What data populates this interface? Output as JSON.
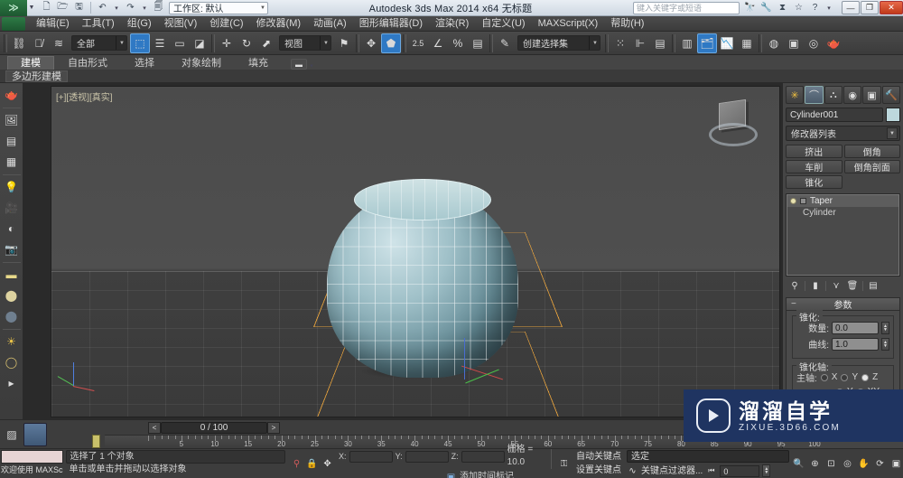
{
  "window": {
    "title": "Autodesk 3ds Max  2014 x64    无标题",
    "workspace_label": "工作区: 默认",
    "search_placeholder": "键入关键字或短语",
    "minimize": "—",
    "maximize": "❐",
    "close": "✕",
    "quick_icons": [
      "new-icon",
      "open-icon",
      "save-icon",
      "undo-icon",
      "redo-icon",
      "set-project-icon"
    ],
    "help_icons": [
      "binoculars-icon",
      "wrench-icon",
      "hourglass-icon",
      "star-icon",
      "help-icon"
    ]
  },
  "menu": {
    "items": [
      {
        "label": "编辑(E)"
      },
      {
        "label": "工具(T)"
      },
      {
        "label": "组(G)"
      },
      {
        "label": "视图(V)"
      },
      {
        "label": "创建(C)"
      },
      {
        "label": "修改器(M)"
      },
      {
        "label": "动画(A)"
      },
      {
        "label": "图形编辑器(D)"
      },
      {
        "label": "渲染(R)"
      },
      {
        "label": "自定义(U)"
      },
      {
        "label": "MAXScript(X)"
      },
      {
        "label": "帮助(H)"
      }
    ]
  },
  "toolbar": {
    "selection_filter": "全部",
    "ref_coord_system": "视图",
    "named_selection_set": "创建选择集",
    "icons": [
      {
        "name": "select-link-icon",
        "glyph": "⛓"
      },
      {
        "name": "unlink-selection-icon",
        "glyph": "⛓"
      },
      {
        "name": "bind-to-space-warp-icon",
        "glyph": "≋"
      },
      {
        "name": "select-object-icon",
        "glyph": "⬚"
      },
      {
        "name": "select-by-name-icon",
        "glyph": "☰"
      },
      {
        "name": "rectangular-select-region-icon",
        "glyph": "▭"
      },
      {
        "name": "window-crossing-icon",
        "glyph": "◩"
      },
      {
        "name": "select-and-move-icon",
        "glyph": "✛"
      },
      {
        "name": "select-and-rotate-icon",
        "glyph": "↻"
      },
      {
        "name": "select-and-scale-icon",
        "glyph": "⬈"
      },
      {
        "name": "use-pivot-point-center-icon",
        "glyph": "▣"
      },
      {
        "name": "snap-toggle-icon",
        "glyph": "2.5"
      },
      {
        "name": "angle-snap-icon",
        "glyph": "∠"
      },
      {
        "name": "percent-snap-icon",
        "glyph": "%"
      },
      {
        "name": "spinner-snap-icon",
        "glyph": "▤"
      },
      {
        "name": "edit-named-selection-icon",
        "glyph": "✎"
      },
      {
        "name": "mirror-icon",
        "glyph": "⁘"
      },
      {
        "name": "align-icon",
        "glyph": "⊨"
      },
      {
        "name": "layer-manager-icon",
        "glyph": "▤"
      },
      {
        "name": "toggle-scene-explorer-icon",
        "glyph": "▥"
      },
      {
        "name": "curve-editor-icon",
        "glyph": "📈"
      },
      {
        "name": "schematic-view-icon",
        "glyph": "▦"
      },
      {
        "name": "material-editor-icon",
        "glyph": "◉"
      },
      {
        "name": "render-setup-icon",
        "glyph": "▣"
      },
      {
        "name": "rendered-frame-window-icon",
        "glyph": "◎"
      },
      {
        "name": "render-production-icon",
        "glyph": "🫖"
      }
    ]
  },
  "ribbon": {
    "tabs": [
      {
        "label": "建模",
        "active": true
      },
      {
        "label": "自由形式",
        "active": false
      },
      {
        "label": "选择",
        "active": false
      },
      {
        "label": "对象绘制",
        "active": false
      },
      {
        "label": "填充",
        "active": false
      }
    ],
    "subtab": "多边形建模",
    "minimize_glyph": "▬"
  },
  "left_toolbar": {
    "items": [
      {
        "name": "teapot-tool-icon",
        "glyph": "🫖"
      },
      {
        "name": "render-preview-icon",
        "glyph": "▣"
      },
      {
        "name": "scene-panel-icon",
        "glyph": "▤"
      },
      {
        "name": "grid-panel-icon",
        "glyph": "▦"
      },
      {
        "name": "omni-light-icon",
        "glyph": "💡"
      },
      {
        "name": "camera-icon",
        "glyph": "🎥"
      },
      {
        "name": "shadow-icon",
        "glyph": "◐"
      },
      {
        "name": "render-camera-icon",
        "glyph": "📷"
      },
      {
        "name": "material-slot-icon",
        "glyph": "▭"
      },
      {
        "name": "sphere-material-icon",
        "glyph": "⬤"
      },
      {
        "name": "sun-icon",
        "glyph": "☀"
      },
      {
        "name": "environment-icon",
        "glyph": "◯"
      },
      {
        "name": "expand-icon",
        "glyph": "▸"
      }
    ]
  },
  "viewport": {
    "label": "[+][透视][真实]",
    "object_name": "Cylinder001",
    "viewcube_name": "view-cube"
  },
  "command_panel": {
    "tabs": [
      {
        "name": "create-tab",
        "glyph": "✳",
        "active": false
      },
      {
        "name": "modify-tab",
        "glyph": "⌒",
        "active": true
      },
      {
        "name": "hierarchy-tab",
        "glyph": "⛬",
        "active": false
      },
      {
        "name": "motion-tab",
        "glyph": "◉",
        "active": false
      },
      {
        "name": "display-tab",
        "glyph": "▣",
        "active": false
      },
      {
        "name": "utilities-tab",
        "glyph": "🔨",
        "active": false
      }
    ],
    "object_name": "Cylinder001",
    "color_swatch": "#bdd8dd",
    "modifier_list_label": "修改器列表",
    "modifier_buttons": [
      {
        "label": "挤出"
      },
      {
        "label": "倒角"
      },
      {
        "label": "车削"
      },
      {
        "label": "倒角剖面"
      },
      {
        "label": "锥化"
      }
    ],
    "stack": [
      {
        "label": "Taper",
        "selected": true
      },
      {
        "label": "Cylinder",
        "selected": false
      }
    ],
    "stack_buttons": [
      {
        "name": "pin-stack-icon",
        "glyph": "⚲"
      },
      {
        "name": "show-end-result-icon",
        "glyph": "▮"
      },
      {
        "name": "make-unique-icon",
        "glyph": "⋎"
      },
      {
        "name": "remove-modifier-icon",
        "glyph": "🗑"
      },
      {
        "name": "configure-modifier-sets-icon",
        "glyph": "▤"
      }
    ],
    "rollout": {
      "title": "参数",
      "minus": "−",
      "groups": [
        {
          "title": "锥化:",
          "fields": [
            {
              "label": "数量:",
              "value": "0.0"
            },
            {
              "label": "曲线:",
              "value": "1.0"
            }
          ]
        },
        {
          "title": "锥化轴:",
          "radio_rows": [
            {
              "label": "主轴:",
              "options": [
                {
                  "label": "X",
                  "on": false
                },
                {
                  "label": "Y",
                  "on": false
                },
                {
                  "label": "Z",
                  "on": true
                }
              ]
            },
            {
              "label": "",
              "options": [
                {
                  "label": "Y",
                  "on": false
                },
                {
                  "label": "XY",
                  "on": true
                }
              ]
            }
          ]
        }
      ]
    }
  },
  "timeline": {
    "current_frame_label": "0 / 100",
    "prev_glyph": "<",
    "next_glyph": ">",
    "key_mode_icon": "key-mode-icon",
    "ruler_start": 0,
    "ruler_end": 100,
    "ruler_step": 5,
    "tick_labels": [
      5,
      10,
      15,
      20,
      25,
      30,
      35,
      40,
      45,
      50,
      55,
      60,
      65,
      70,
      75,
      80,
      85,
      90,
      95,
      100
    ],
    "slider_frame": 0
  },
  "status_bar": {
    "listener_label": "欢迎使用 MAXSc",
    "message_top": "选择了 1 个对象",
    "message_bottom": "单击或单击并拖动以选择对象",
    "icons": [
      {
        "name": "pin-stack-status-icon",
        "glyph": "⚲"
      },
      {
        "name": "lock-selection-icon",
        "glyph": "🔒"
      },
      {
        "name": "absolute-mode-transform-icon",
        "glyph": "✥"
      }
    ],
    "coords": [
      {
        "label": "X:",
        "value": ""
      },
      {
        "label": "Y:",
        "value": ""
      },
      {
        "label": "Z:",
        "value": ""
      }
    ],
    "grid_label": "栅格 = 10.0",
    "add_time_tag": "添加时间标记",
    "add_time_tag_icon": "time-tag-icon",
    "auto_key": "自动关键点",
    "set_key": "设置关键点",
    "key_filters": "关键点过滤器...",
    "selection_set_value": "选定",
    "key_spinner_value": "0",
    "nav_icons": [
      {
        "name": "zoom-icon",
        "glyph": "🔍"
      },
      {
        "name": "zoom-all-icon",
        "glyph": "⊕"
      },
      {
        "name": "zoom-extents-icon",
        "glyph": "⊡"
      },
      {
        "name": "field-of-view-icon",
        "glyph": "◎"
      },
      {
        "name": "pan-view-icon",
        "glyph": "✋"
      },
      {
        "name": "orbit-icon",
        "glyph": "⟳"
      },
      {
        "name": "maximize-viewport-icon",
        "glyph": "▣"
      }
    ]
  },
  "watermark": {
    "title": "溜溜自学",
    "url": "ZIXUE.3D66.COM",
    "bg": "#1f3461"
  }
}
